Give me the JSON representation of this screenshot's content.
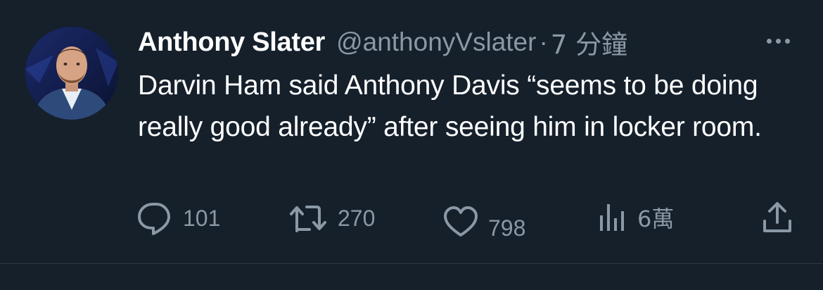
{
  "tweet": {
    "author_name": "Anthony Slater",
    "handle": "@anthonyVslater",
    "separator": "·",
    "time": "7 分鐘",
    "text": "Darvin Ham said Anthony Davis “seems to be doing really good already” after seeing him in locker room.",
    "actions": {
      "replies": "101",
      "retweets": "270",
      "likes": "798",
      "views": "6萬"
    }
  },
  "theme": {
    "background": "#15202b",
    "text": "#ffffff",
    "muted": "#8b98a5"
  },
  "icons": [
    "reply-icon",
    "retweet-icon",
    "like-icon",
    "views-icon",
    "share-icon",
    "more-icon"
  ]
}
